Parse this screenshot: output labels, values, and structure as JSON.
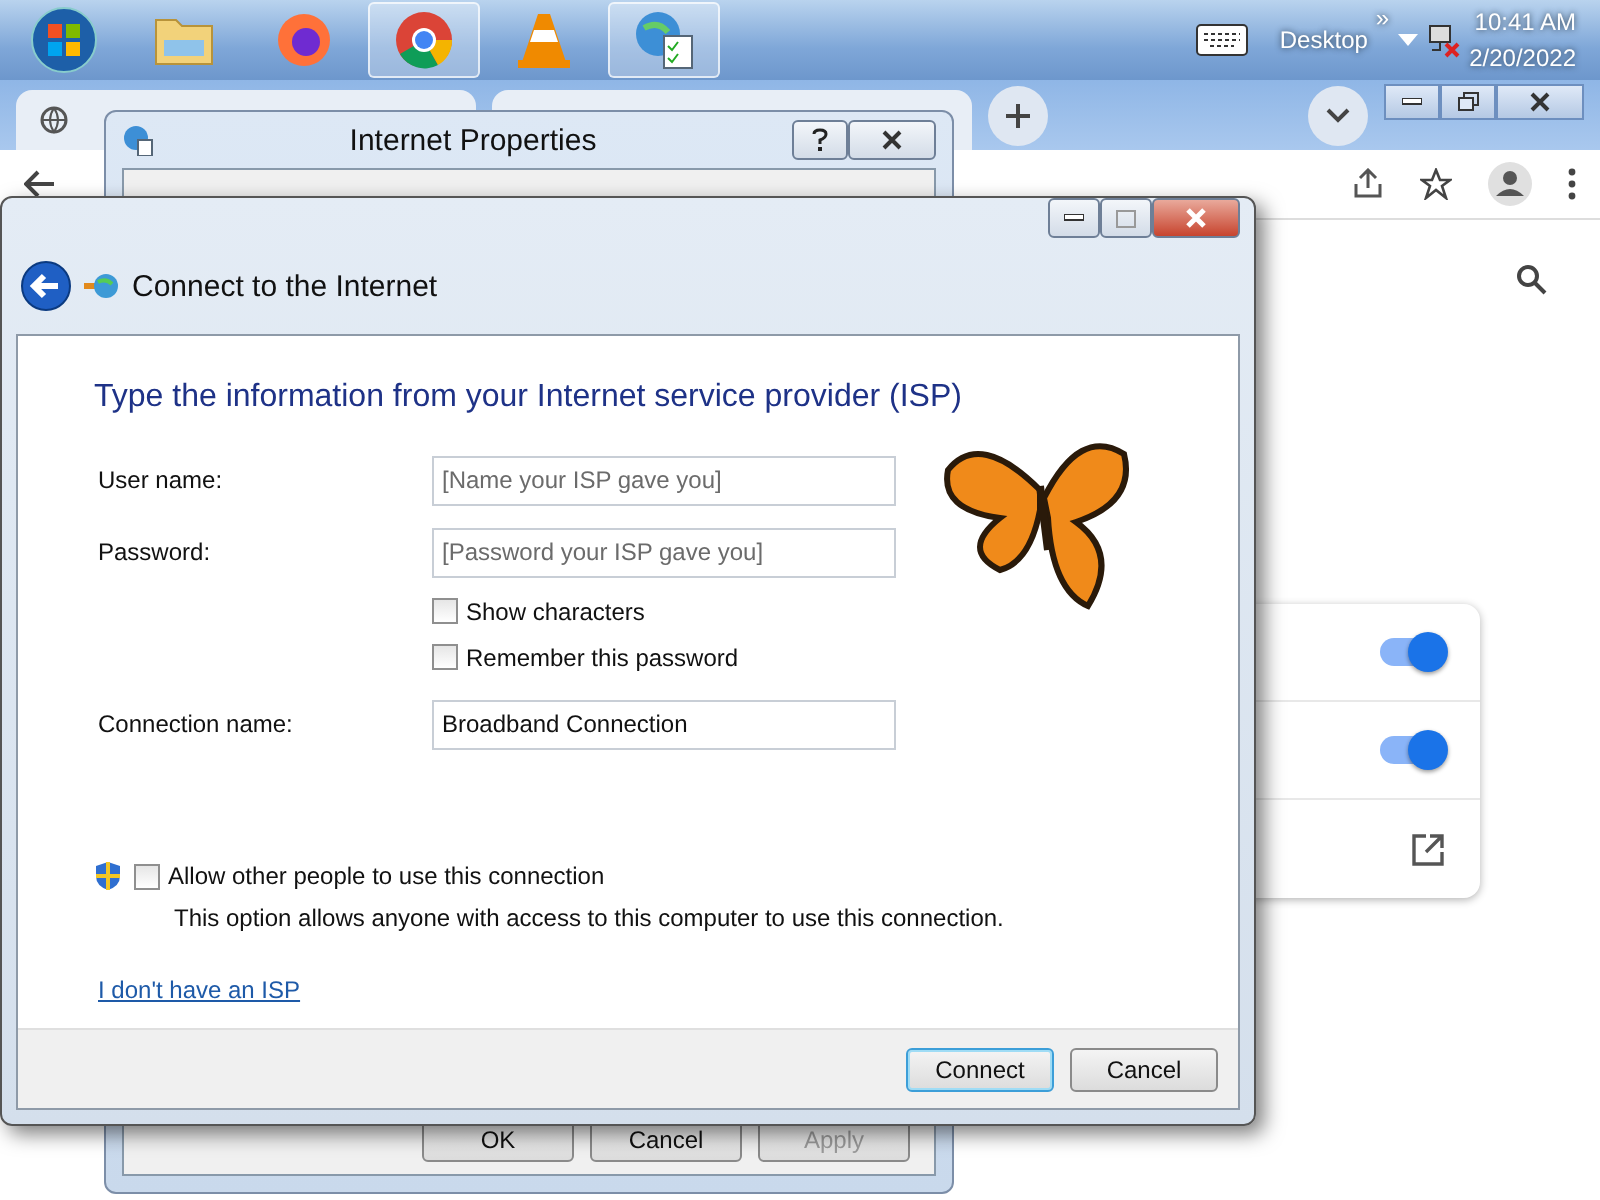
{
  "taskbar": {
    "apps": [
      {
        "kind": "start",
        "selected": false
      },
      {
        "kind": "folder",
        "selected": false
      },
      {
        "kind": "firefox",
        "selected": false
      },
      {
        "kind": "chrome",
        "selected": true
      },
      {
        "kind": "vlc",
        "selected": false
      },
      {
        "kind": "network",
        "selected": true
      }
    ],
    "tray": {
      "desktop": "Desktop",
      "chevron": "»",
      "time": "10:41 AM",
      "date": "2/20/2022"
    }
  },
  "browser": {
    "toggles": [
      {
        "on": true
      },
      {
        "on": true
      }
    ]
  },
  "internet_properties": {
    "title": "Internet Properties",
    "buttons": [
      {
        "label": "OK",
        "disabled": false
      },
      {
        "label": "Cancel",
        "disabled": false
      },
      {
        "label": "Apply",
        "disabled": true
      }
    ]
  },
  "wizard": {
    "title": "Connect to the Internet",
    "heading": "Type the information from your Internet service provider (ISP)",
    "fields": [
      {
        "label": "User name:",
        "placeholder": "[Name your ISP gave you]"
      },
      {
        "label": "Password:",
        "placeholder": "[Password your ISP gave you]"
      }
    ],
    "options": [
      {
        "label": "Show characters",
        "checked": false
      },
      {
        "label": "Remember this password",
        "checked": false
      }
    ],
    "connection_name": {
      "label": "Connection name:",
      "value": "Broadband Connection"
    },
    "share": {
      "label": "Allow other people to use this connection",
      "checked": false,
      "note": "This option allows anyone with access to this computer to use this connection."
    },
    "link": "I don't have an ISP",
    "buttons": [
      {
        "label": "Connect",
        "default": true
      },
      {
        "label": "Cancel",
        "default": false
      }
    ]
  }
}
